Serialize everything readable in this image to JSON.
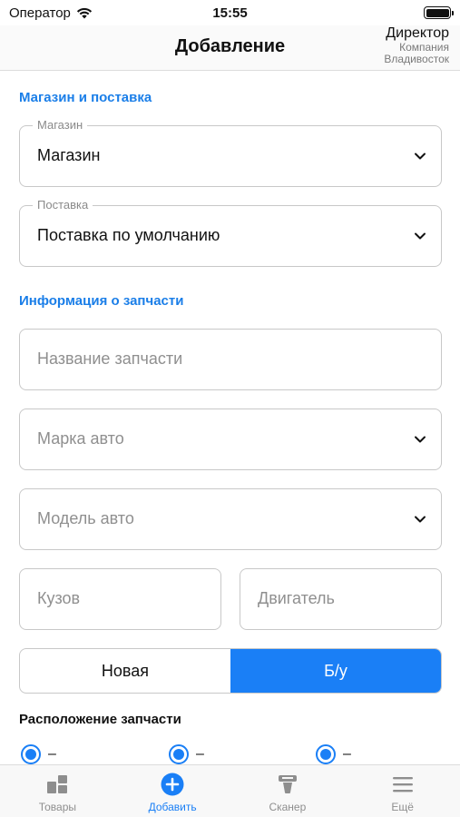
{
  "status_bar": {
    "carrier": "Оператор",
    "time": "15:55"
  },
  "nav": {
    "title": "Добавление",
    "user_role": "Директор",
    "company": "Компания",
    "city": "Владивосток"
  },
  "sections": {
    "store_supply": "Магазин и поставка",
    "part_info": "Информация о запчасти"
  },
  "fields": {
    "store": {
      "label": "Магазин",
      "value": "Магазин"
    },
    "supply": {
      "label": "Поставка",
      "value": "Поставка по умолчанию"
    },
    "part_name": {
      "placeholder": "Название запчасти"
    },
    "car_make": {
      "placeholder": "Марка авто"
    },
    "car_model": {
      "placeholder": "Модель авто"
    },
    "body": {
      "placeholder": "Кузов"
    },
    "engine": {
      "placeholder": "Двигатель"
    }
  },
  "condition": {
    "options": [
      "Новая",
      "Б/у"
    ],
    "selected": "Б/у"
  },
  "location": {
    "title": "Расположение запчасти",
    "radios": [
      "–",
      "–",
      "–"
    ]
  },
  "tab_bar": {
    "items": [
      {
        "label": "Товары",
        "icon": "grid-icon"
      },
      {
        "label": "Добавить",
        "icon": "plus-circle-icon"
      },
      {
        "label": "Сканер",
        "icon": "scanner-icon"
      },
      {
        "label": "Ещё",
        "icon": "menu-icon"
      }
    ],
    "active": "Добавить"
  },
  "colors": {
    "accent": "#1a7ff6",
    "section_title": "#1a7ee8"
  }
}
